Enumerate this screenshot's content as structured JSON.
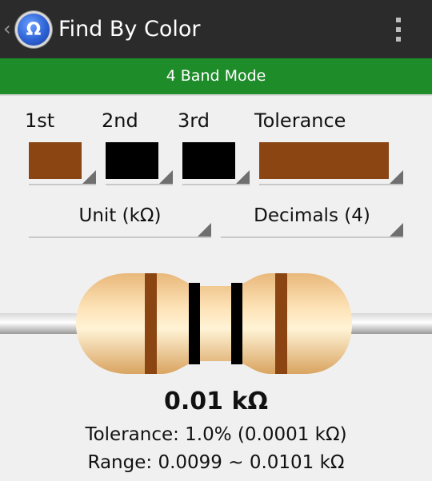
{
  "actionbar": {
    "title": "Find By Color",
    "back_glyph": "‹",
    "app_icon_glyph": "Ω",
    "icons": [
      "back-chevron-icon",
      "app-omega-icon",
      "overflow-menu-icon"
    ]
  },
  "mode": {
    "label": "4 Band Mode",
    "color": "#1f8c2a"
  },
  "bands": [
    {
      "label": "1st",
      "color": "#8b4513"
    },
    {
      "label": "2nd",
      "color": "#000000"
    },
    {
      "label": "3rd",
      "color": "#000000"
    },
    {
      "label": "Tolerance",
      "color": "#8b4513"
    }
  ],
  "unit_dropdown": {
    "value": "Unit (kΩ)"
  },
  "decimals_dropdown": {
    "value": "Decimals (4)"
  },
  "result": {
    "value": "0.01 kΩ",
    "tolerance": "Tolerance: 1.0% (0.0001 kΩ)",
    "range": "Range: 0.0099 ~ 0.0101 kΩ"
  }
}
